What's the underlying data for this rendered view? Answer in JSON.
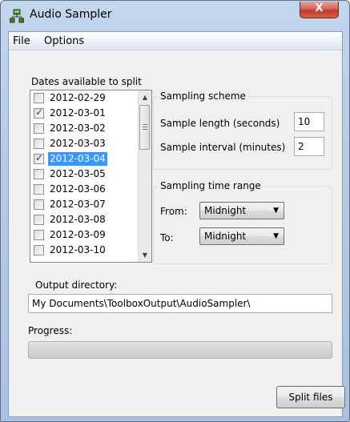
{
  "window": {
    "title": "Audio Sampler",
    "close_glyph": "X"
  },
  "menu": {
    "file": "File",
    "options": "Options"
  },
  "dates": {
    "label": "Dates available to split",
    "items": [
      {
        "label": "2012-02-29",
        "checked": false,
        "selected": false
      },
      {
        "label": "2012-03-01",
        "checked": true,
        "selected": false
      },
      {
        "label": "2012-03-02",
        "checked": false,
        "selected": false
      },
      {
        "label": "2012-03-03",
        "checked": false,
        "selected": false
      },
      {
        "label": "2012-03-04",
        "checked": true,
        "selected": true
      },
      {
        "label": "2012-03-05",
        "checked": false,
        "selected": false
      },
      {
        "label": "2012-03-06",
        "checked": false,
        "selected": false
      },
      {
        "label": "2012-03-07",
        "checked": false,
        "selected": false
      },
      {
        "label": "2012-03-08",
        "checked": false,
        "selected": false
      },
      {
        "label": "2012-03-09",
        "checked": false,
        "selected": false
      },
      {
        "label": "2012-03-10",
        "checked": false,
        "selected": false
      }
    ]
  },
  "scheme": {
    "title": "Sampling scheme",
    "length_label": "Sample length (seconds)",
    "length_value": "10",
    "interval_label": "Sample interval (minutes)",
    "interval_value": "2"
  },
  "range": {
    "title": "Sampling time range",
    "from_label": "From:",
    "from_value": "Midnight",
    "to_label": "To:",
    "to_value": "Midnight"
  },
  "output": {
    "label": "Output directory:",
    "value": "My Documents\\ToolboxOutput\\AudioSampler\\"
  },
  "progress": {
    "label": "Progress:",
    "value": 0
  },
  "split_button": "Split files",
  "colors": {
    "selection": "#3399ff",
    "close": "#c23a2b",
    "frame": "#b5cbe6"
  }
}
